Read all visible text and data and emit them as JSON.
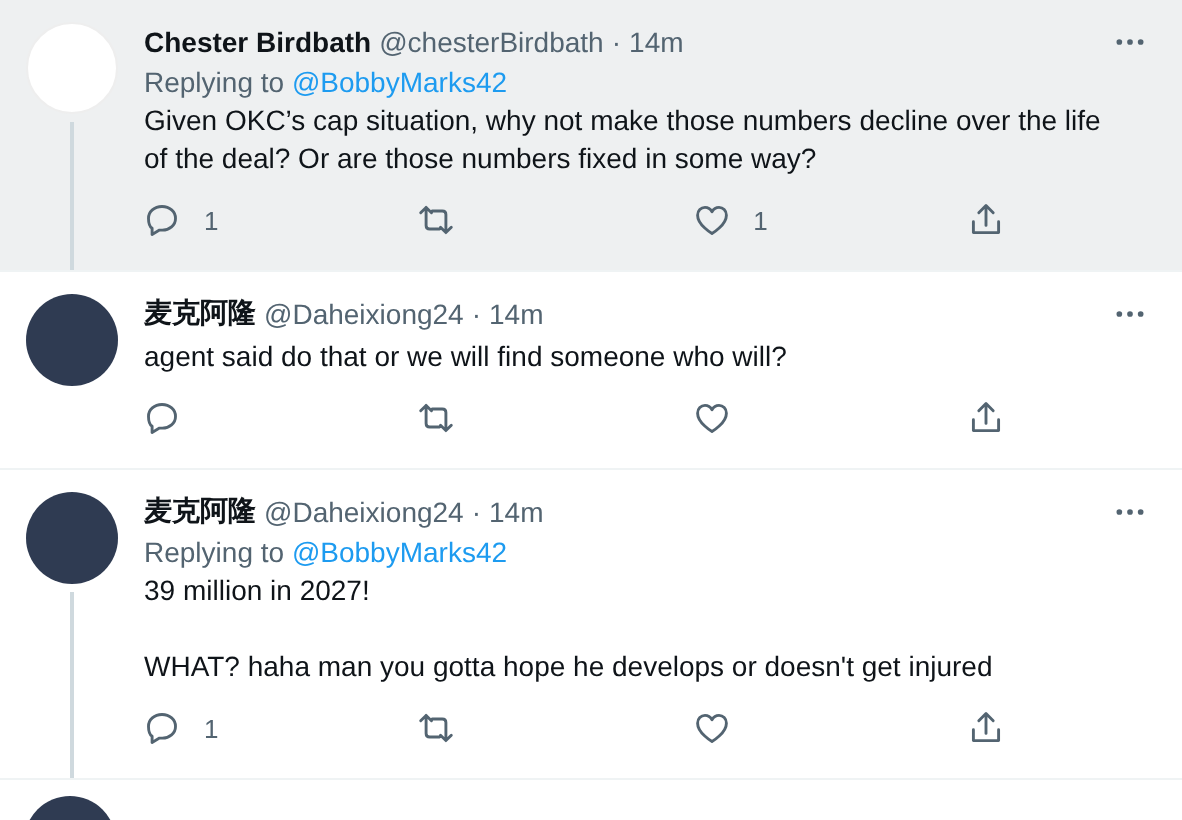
{
  "tweets": [
    {
      "name": "Chester Birdbath",
      "handle": "@chesterBirdbath",
      "separator": "·",
      "time": "14m",
      "highlighted": true,
      "thread_line": true,
      "replying_label": "Replying to",
      "replying_to": "@BobbyMarks42",
      "paragraphs": [
        "Given OKC’s cap situation, why not make those numbers decline over the life of the deal? Or are those numbers fixed in some way?"
      ],
      "actions": [
        {
          "kind": "reply",
          "count": "1"
        },
        {
          "kind": "retweet"
        },
        {
          "kind": "like",
          "count": "1"
        },
        {
          "kind": "share"
        }
      ]
    },
    {
      "name": "麦克阿隆",
      "handle": "@Daheixiong24",
      "separator": "·",
      "time": "14m",
      "highlighted": false,
      "thread_line": false,
      "paragraphs": [
        "agent said do that or we will find someone who will?"
      ],
      "actions": [
        {
          "kind": "reply"
        },
        {
          "kind": "retweet"
        },
        {
          "kind": "like"
        },
        {
          "kind": "share"
        }
      ]
    },
    {
      "name": "麦克阿隆",
      "handle": "@Daheixiong24",
      "separator": "·",
      "time": "14m",
      "highlighted": false,
      "thread_line": true,
      "replying_label": "Replying to",
      "replying_to": "@BobbyMarks42",
      "paragraphs": [
        "39 million in 2027!",
        "WHAT? haha man you gotta hope he develops or doesn't get injured"
      ],
      "actions": [
        {
          "kind": "reply",
          "count": "1"
        },
        {
          "kind": "retweet"
        },
        {
          "kind": "like"
        },
        {
          "kind": "share"
        }
      ]
    }
  ]
}
